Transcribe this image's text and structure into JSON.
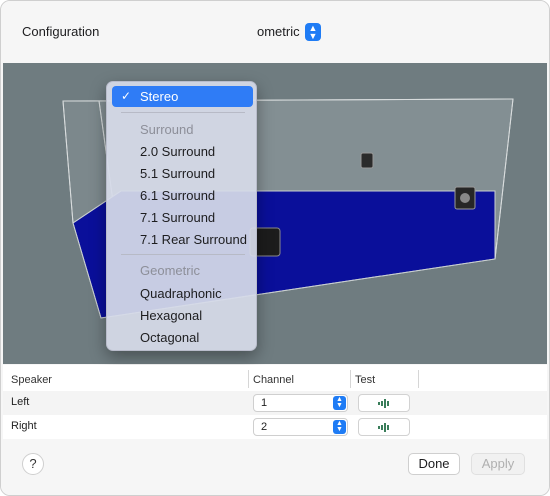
{
  "configuration": {
    "label": "Configuration",
    "popup_value_visible": "ometric",
    "stepper_glyph": "⬍"
  },
  "menu": {
    "selected": {
      "check": "✓",
      "label": "Stereo"
    },
    "groups": [
      {
        "header": "Surround",
        "items": [
          "2.0 Surround",
          "5.1 Surround",
          "6.1 Surround",
          "7.1 Surround",
          "7.1 Rear Surround"
        ]
      },
      {
        "header": "Geometric",
        "items": [
          "Quadraphonic",
          "Hexagonal",
          "Octagonal"
        ]
      }
    ]
  },
  "table": {
    "headers": [
      "Speaker",
      "Channel",
      "Test"
    ],
    "rows": [
      {
        "speaker": "Left",
        "channel": "1",
        "test_icon": "speaker-wave-icon"
      },
      {
        "speaker": "Right",
        "channel": "2",
        "test_icon": "speaker-wave-icon"
      }
    ]
  },
  "buttons": {
    "help": "?",
    "done": "Done",
    "apply": "Apply"
  },
  "colors": {
    "accent": "#2f7cf6",
    "floor": "#0a0f9a",
    "background": "#6f7c80"
  }
}
